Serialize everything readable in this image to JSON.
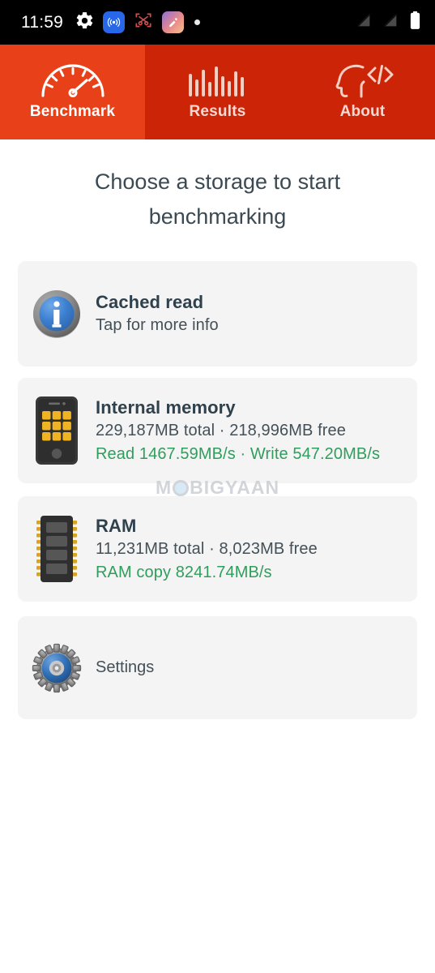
{
  "status_bar": {
    "clock": "11:59",
    "left_icons": [
      "gear-icon",
      "cast-icon",
      "screenshot-cut-icon",
      "gallery-app-icon",
      "notification-dot-icon"
    ],
    "right_icons": [
      "signal-off-icon",
      "signal-off-icon-2",
      "battery-full-icon"
    ]
  },
  "tabs": [
    {
      "label": "Benchmark",
      "icon": "speedometer-icon",
      "active": true
    },
    {
      "label": "Results",
      "icon": "bar-chart-icon",
      "active": false
    },
    {
      "label": "About",
      "icon": "head-code-icon",
      "active": false
    }
  ],
  "heading": "Choose a storage to start benchmarking",
  "cards": [
    {
      "id": "cached",
      "icon": "info-icon",
      "title": "Cached read",
      "subtitle": "Tap for more info",
      "speed": ""
    },
    {
      "id": "internal",
      "icon": "phone-storage-icon",
      "title": "Internal memory",
      "subtitle": "229,187MB total · 218,996MB free",
      "speed": "Read 1467.59MB/s · Write 547.20MB/s"
    },
    {
      "id": "ram",
      "icon": "ram-chip-icon",
      "title": "RAM",
      "subtitle": "11,231MB total · 8,023MB free",
      "speed": "RAM copy 8241.74MB/s"
    }
  ],
  "settings": {
    "icon": "gear-settings-icon",
    "label": "Settings"
  },
  "watermark": {
    "prefix": "M",
    "suffix": "BIGYAAN"
  },
  "colors": {
    "tab_active": "#e8411a",
    "tab_inactive": "#cc2407",
    "card_bg": "#f4f4f4",
    "title_text": "#2f414c",
    "speed_green": "#2f9e5c"
  }
}
